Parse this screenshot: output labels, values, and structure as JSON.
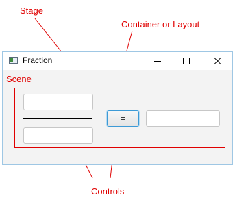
{
  "annotations": {
    "stage": "Stage",
    "container": "Container or Layout",
    "scene": "Scene",
    "controls": "Controls"
  },
  "window": {
    "title": "Fraction",
    "icon": "app-window-icon",
    "buttons": [
      "minimize-icon",
      "maximize-icon",
      "close-icon"
    ]
  },
  "form": {
    "numerator_value": "",
    "denominator_value": "",
    "result_value": "",
    "equals_label": "="
  },
  "colors": {
    "annotation": "#e00000",
    "window_border": "#9fc7e4",
    "window_bg": "#f3f3f3",
    "button_focus": "#3d9ad6"
  }
}
